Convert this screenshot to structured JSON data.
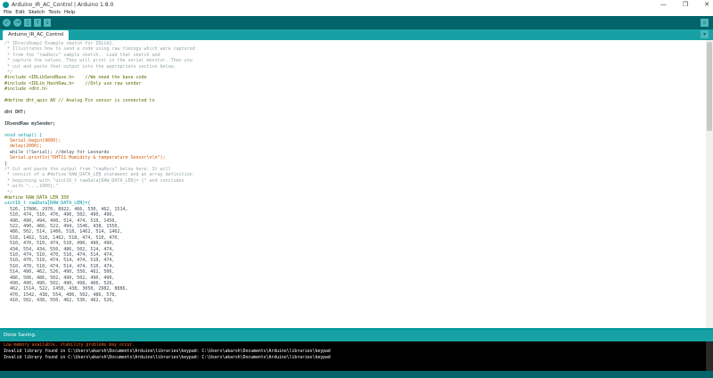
{
  "window": {
    "title": "Arduino_IR_AC_Control | Arduino 1.8.0",
    "minimize_glyph": "—",
    "maximize_glyph": "❐",
    "close_glyph": "✕"
  },
  "menu": {
    "items": [
      "File",
      "Edit",
      "Sketch",
      "Tools",
      "Help"
    ]
  },
  "toolbar": {
    "verify_glyph": "✓",
    "upload_glyph": "→",
    "new_glyph": "▯",
    "open_glyph": "↑",
    "save_glyph": "↓",
    "serial_glyph": "⌕"
  },
  "tabs": {
    "active": "Arduino_IR_AC_Control",
    "menu_glyph": "▾"
  },
  "editor": {
    "lines": [
      {
        "t": "/* IRrecvDump2 Example sketch for IRLib2.",
        "c": "c-comment"
      },
      {
        "t": " * Illustrates how to send a code using raw timings which were captured",
        "c": "c-comment"
      },
      {
        "t": " * from the \"rawRecv\" sample sketch.  Load that sketch and",
        "c": "c-comment"
      },
      {
        "t": " * capture the values. They will print in the serial monitor. Then you",
        "c": "c-comment"
      },
      {
        "t": " * cut and paste that output into the appropriate section below.",
        "c": "c-comment"
      },
      {
        "t": " */",
        "c": "c-comment"
      },
      {
        "t": "#include <IRLibSendBase.h>    //We need the base code",
        "c": "c-pre"
      },
      {
        "t": "#include <IRLib_HashRaw.h>    //Only use raw sender",
        "c": "c-pre"
      },
      {
        "t": "#include <dht.h>",
        "c": "c-pre"
      },
      {
        "t": "",
        "c": ""
      },
      {
        "t": "#define dht_apin A0 // Analog Pin sensor is connected to",
        "c": "c-pre"
      },
      {
        "t": "",
        "c": ""
      },
      {
        "t": "dht DHT;",
        "c": "c-bold"
      },
      {
        "t": "",
        "c": ""
      },
      {
        "t": "IRsendRaw mySender;",
        "c": "c-bold"
      },
      {
        "t": "",
        "c": ""
      },
      {
        "t": "void setup() {",
        "c": "c-type"
      },
      {
        "t": "  Serial.begin(9600);",
        "c": "c-fn"
      },
      {
        "t": "  delay(2000);",
        "c": "c-fn"
      },
      {
        "t": "  while (!Serial); //delay for Leonardo",
        "c": ""
      },
      {
        "t": "  Serial.println(\"DHT11 Humidity & temperature Sensor\\n\\n\");",
        "c": "c-fn"
      },
      {
        "t": "}",
        "c": ""
      },
      {
        "t": "/* Cut and paste the output from \"rawRecv\" below here. It will",
        "c": "c-comment"
      },
      {
        "t": " * consist of a #define RAW_DATA_LEN statement and an array definition",
        "c": "c-comment"
      },
      {
        "t": " * beginning with \"uint16_t rawData[RAW_DATA_LEN]= {\" and concludes",
        "c": "c-comment"
      },
      {
        "t": " * with \"...,1000};\"",
        "c": "c-comment"
      },
      {
        "t": " */",
        "c": "c-comment"
      },
      {
        "t": "#define RAW_DATA_LEN 350",
        "c": "c-pre"
      },
      {
        "t": "uint16_t rawData[RAW_DATA_LEN]={",
        "c": "c-type"
      },
      {
        "t": "  526, 17806, 2970, 8922, 466, 530, 462, 1514,",
        "c": ""
      },
      {
        "t": "  510, 474, 510, 470, 490, 502, 490, 490,",
        "c": ""
      },
      {
        "t": "  490, 490, 494, 490, 514, 474, 510, 1450,",
        "c": ""
      },
      {
        "t": "  522, 490, 466, 522, 494, 1546, 438, 1550,",
        "c": ""
      },
      {
        "t": "  486, 502, 514, 1466, 518, 1462, 514, 1462,",
        "c": ""
      },
      {
        "t": "  518, 1462, 518, 1462, 518, 474, 510, 470,",
        "c": ""
      },
      {
        "t": "  510, 470, 510, 474, 510, 490, 490, 490,",
        "c": ""
      },
      {
        "t": "  434, 554, 434, 550, 486, 502, 514, 474,",
        "c": ""
      },
      {
        "t": "  510, 474, 510, 470, 510, 474, 514, 474,",
        "c": ""
      },
      {
        "t": "  510, 470, 510, 474, 514, 474, 510, 474,",
        "c": ""
      },
      {
        "t": "  510, 470, 510, 474, 514, 474, 510, 474,",
        "c": ""
      },
      {
        "t": "  514, 490, 462, 526, 490, 550, 462, 506,",
        "c": ""
      },
      {
        "t": "  486, 506, 486, 502, 490, 502, 490, 490,",
        "c": ""
      },
      {
        "t": "  490, 490, 490, 502, 490, 498, 466, 526,",
        "c": ""
      },
      {
        "t": "  462, 1514, 522, 1458, 438, 3050, 2982, 8886,",
        "c": ""
      },
      {
        "t": "  470, 1542, 438, 554, 486, 502, 486, 578,",
        "c": ""
      },
      {
        "t": "  410, 502, 438, 550, 462, 530, 462, 526,",
        "c": ""
      }
    ]
  },
  "status": {
    "text": "Done Saving."
  },
  "console": {
    "lines": [
      {
        "t": "Low memory available, stability problems may occur.",
        "c": "con-warn"
      },
      {
        "t": "Invalid library found in C:\\Users\\akarsh\\Documents\\Arduino\\libraries\\keypad: C:\\Users\\akarsh\\Documents\\Arduino\\libraries\\keypad",
        "c": "con-err"
      },
      {
        "t": "Invalid library found in C:\\Users\\akarsh\\Documents\\Arduino\\libraries\\keypad: C:\\Users\\akarsh\\Documents\\Arduino\\libraries\\keypad",
        "c": "con-err"
      }
    ]
  }
}
